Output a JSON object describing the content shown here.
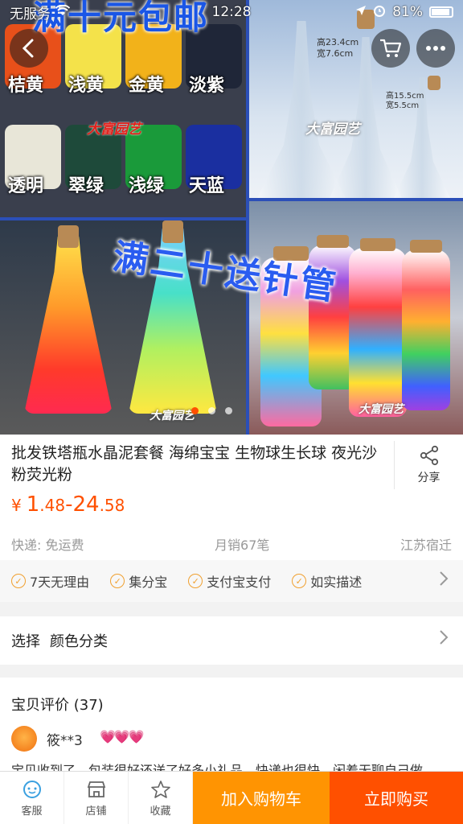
{
  "status_bar": {
    "carrier": "无服务",
    "time": "12:28",
    "battery": "81%"
  },
  "hero": {
    "promo_top": "满十元包邮",
    "promo_mid": "满二十送针管",
    "watermark": "大富园艺",
    "extra_watermark": "大富园艺",
    "bottle_label_1": "高23.4cm",
    "bottle_label_2": "宽7.6cm",
    "bottle_label_3": "高15.5cm",
    "bottle_label_4": "宽5.5cm",
    "bead_colors": [
      {
        "label": "桔黄",
        "color": "#e8501a"
      },
      {
        "label": "浅黄",
        "color": "#f4e24a"
      },
      {
        "label": "金黄",
        "color": "#f2b21a"
      },
      {
        "label": "淡紫",
        "color": "#1f2638"
      },
      {
        "label": "透明",
        "color": "#e8e6d8"
      },
      {
        "label": "翠绿",
        "color": "#1e4a3a"
      },
      {
        "label": "浅绿",
        "color": "#1a9a3a"
      },
      {
        "label": "天蓝",
        "color": "#1a2fa0"
      }
    ],
    "page_total": 3,
    "page_active": 1
  },
  "product": {
    "title": "批发铁塔瓶水晶泥套餐 海绵宝宝 生物球生长球 夜光沙粉荧光粉",
    "share_label": "分享",
    "price_symbol": "¥",
    "price_low_int": "1",
    "price_low_dec": ".48",
    "price_dash": "-",
    "price_high_int": "24",
    "price_high_dec": ".58",
    "shipping": "快递: 免运费",
    "monthly_sales": "月销67笔",
    "location": "江苏宿迁"
  },
  "guarantees": [
    "7天无理由",
    "集分宝",
    "支付宝支付",
    "如实描述"
  ],
  "select": {
    "label": "选择",
    "value": "颜色分类"
  },
  "reviews": {
    "title": "宝贝评价 (37)",
    "user": "筱**3",
    "hearts": "💗💗💗",
    "text": "宝贝收到了，包装很好还送了好多小礼品，快递也很快，闲着无聊自己做"
  },
  "bottom_bar": {
    "service": "客服",
    "shop": "店铺",
    "favorite": "收藏",
    "add_cart": "加入购物车",
    "buy_now": "立即购买"
  }
}
